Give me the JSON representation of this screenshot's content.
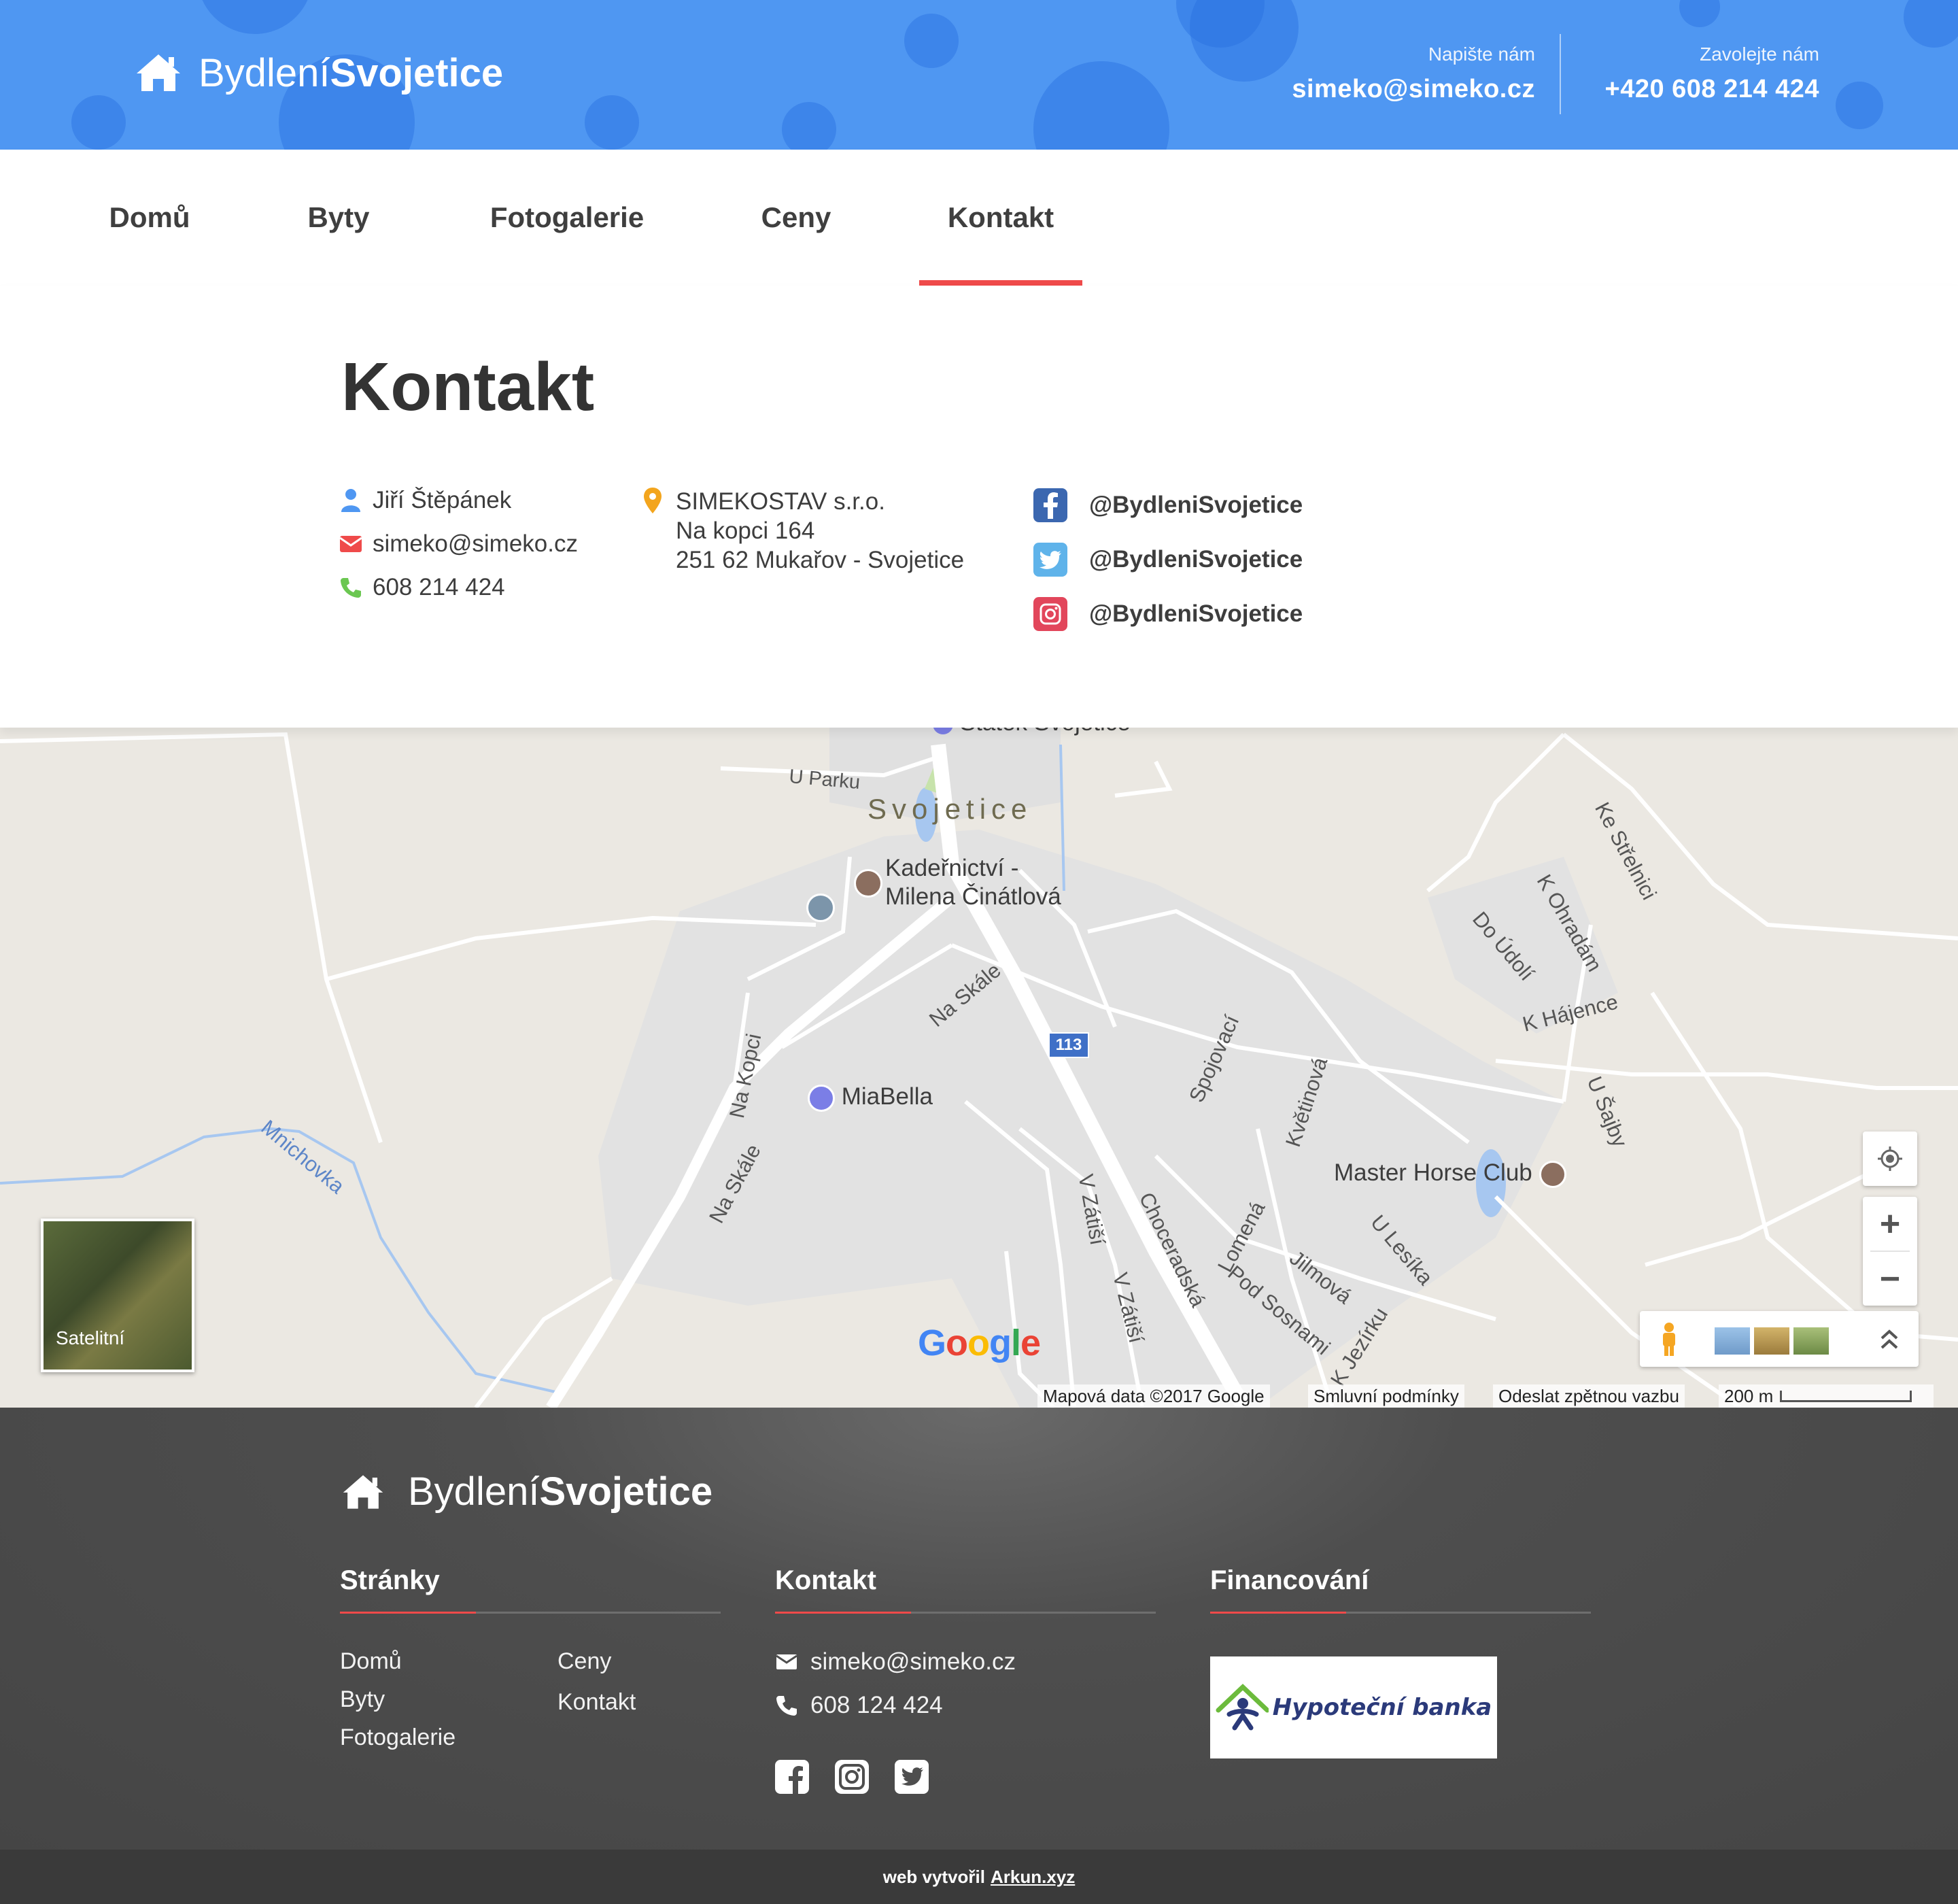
{
  "brand": {
    "light": "Bydlení",
    "bold": "Svojetice"
  },
  "header": {
    "write_label": "Napište nám",
    "email": "simeko@simeko.cz",
    "call_label": "Zavolejte nám",
    "phone": "+420 608 214 424"
  },
  "nav": {
    "items": [
      {
        "label": "Domů"
      },
      {
        "label": "Byty"
      },
      {
        "label": "Fotogalerie"
      },
      {
        "label": "Ceny"
      },
      {
        "label": "Kontakt"
      }
    ],
    "active": "Kontakt"
  },
  "contact": {
    "title": "Kontakt",
    "person": "Jiří Štěpánek",
    "email": "simeko@simeko.cz",
    "phone": "608 214 424",
    "company": "SIMEKOSTAV s.r.o.",
    "street": "Na kopci 164",
    "city": "251 62 Mukařov - Svojetice",
    "social": {
      "facebook": "@BydleniSvojetice",
      "twitter": "@BydleniSvojetice",
      "instagram": "@BydleniSvojetice"
    }
  },
  "map": {
    "labels": {
      "statek": "Statek Svojetice",
      "u_parku": "U Parku",
      "svojetice": "Svojetice",
      "kadernictvi_1": "Kadeřnictví -",
      "kadernictvi_2": "Milena Činátlová",
      "na_skale": "Na Skále",
      "na_skale_2": "Na Skále",
      "na_kopci": "Na Kopci",
      "miabella": "MiaBella",
      "road_113": "113",
      "mnichovka": "Mnichovka",
      "chocerdska": "Choceradská",
      "v_zatisi_1": "V Zátiší",
      "v_zatisi_2": "V Zátiší",
      "spojovaci": "Spojovací",
      "kvetinova": "Květinová",
      "lomena": "Lomená",
      "pod_sosnami": "Pod Sosnami",
      "jilmova": "Jilmová",
      "k_jeziku": "K Jezírku",
      "u_lesika": "U Lesíka",
      "master_horse": "Master Horse Club",
      "ke_strelnici": "Ke Střelnici",
      "k_ohradam": "K Ohradám",
      "do_udoli": "Do Údolí",
      "k_hajence": "K Hájence",
      "u_sajby": "U Šajby"
    },
    "satellite_label": "Satelitní",
    "google": "Google",
    "attribution": "Mapová data ©2017 Google",
    "terms": "Smluvní podmínky",
    "feedback": "Odeslat zpětnou vazbu",
    "scale": "200 m",
    "zoom_in": "+",
    "zoom_out": "−"
  },
  "footer": {
    "pages_title": "Stránky",
    "pages": [
      "Domů",
      "Byty",
      "Fotogalerie",
      "Ceny",
      "Kontakt"
    ],
    "contact_title": "Kontakt",
    "email": "simeko@simeko.cz",
    "phone": "608 124 424",
    "financing_title": "Financování",
    "bank_name": "Hypoteční banka",
    "credit_prefix": "web vytvořil",
    "credit_link": "Arkun.xyz"
  },
  "colors": {
    "header_blue": "#4f97f2",
    "accent_red": "#ef4a4a",
    "footer_dark": "#4e4e4e"
  }
}
